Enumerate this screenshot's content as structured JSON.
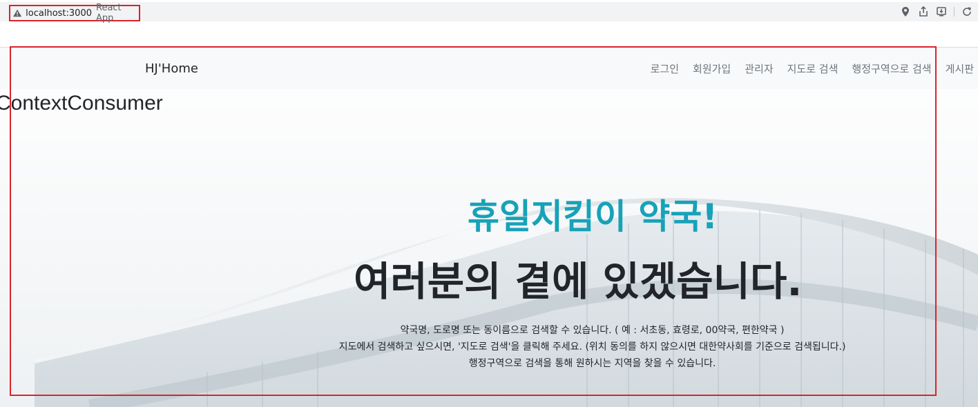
{
  "browser": {
    "url": "localhost:3000",
    "tab_title": "React App"
  },
  "navbar": {
    "brand": "HJ'Home",
    "items": [
      {
        "label": "로그인"
      },
      {
        "label": "회원가입"
      },
      {
        "label": "관리자"
      },
      {
        "label": "지도로 검색"
      },
      {
        "label": "행정구역으로 검색"
      },
      {
        "label": "게시판"
      }
    ]
  },
  "context_label": "ContextConsumer",
  "hero": {
    "title": "휴일지킴이 약국!",
    "subtitle": "여러분의 곁에 있겠습니다.",
    "desc_lines": [
      "약국명, 도로명 또는 동이름으로 검색할 수 있습니다. ( 예 : 서초동, 효령로, 00약국, 편한약국 )",
      "지도에서 검색하고 싶으시면, '지도로 검색'을 클릭해 주세요. (위치 동의를 하지 않으시면 대한약사회를 기준으로 검색됩니다.)",
      "행정구역으로 검색을 통해 원하시는 지역을 찾을 수 있습니다."
    ]
  },
  "colors": {
    "accent": "#17a2b8",
    "text": "#212529",
    "nav_text": "#6c757d",
    "annotation": "#d8232a"
  },
  "icons": {
    "address_bar": "warning-icon",
    "chrome_actions": [
      "location-icon",
      "share-icon",
      "install-icon",
      "reload-icon"
    ]
  }
}
